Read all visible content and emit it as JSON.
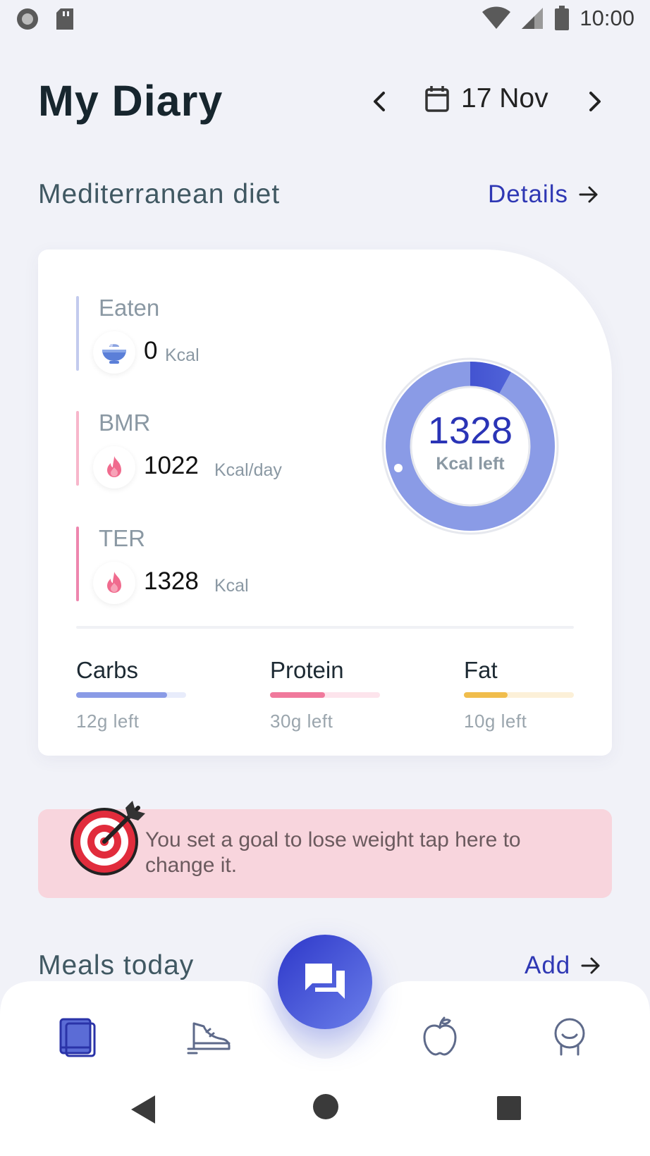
{
  "status_bar": {
    "time": "10:00"
  },
  "header": {
    "title": "My Diary",
    "date": "17 Nov"
  },
  "diet": {
    "title": "Mediterranean diet",
    "details_label": "Details"
  },
  "stats": [
    {
      "label": "Eaten",
      "value": "0",
      "unit": "Kcal"
    },
    {
      "label": "BMR",
      "value": "1022",
      "unit": "Kcal/day"
    },
    {
      "label": "TER",
      "value": "1328",
      "unit": "Kcal"
    }
  ],
  "ring": {
    "value": "1328",
    "label": "Kcal left",
    "progress_fraction": 0.08
  },
  "macros": [
    {
      "name": "Carbs",
      "left": "12g left",
      "fill_fraction": 0.83,
      "color": "#8a9be6",
      "track_color": "#e8ecfb"
    },
    {
      "name": "Protein",
      "left": "30g left",
      "fill_fraction": 0.5,
      "color": "#f0799c",
      "track_color": "#fde4ec"
    },
    {
      "name": "Fat",
      "left": "10g left",
      "fill_fraction": 0.4,
      "color": "#f0bd4c",
      "track_color": "#fcf0d8"
    }
  ],
  "goal": {
    "text": "You set a goal to lose weight tap here to change it."
  },
  "meals": {
    "title": "Meals today",
    "add_label": "Add"
  },
  "colors": {
    "accent": "#2f38b4",
    "ring_light": "#8a9be6",
    "banner": "#f8d5dd"
  }
}
